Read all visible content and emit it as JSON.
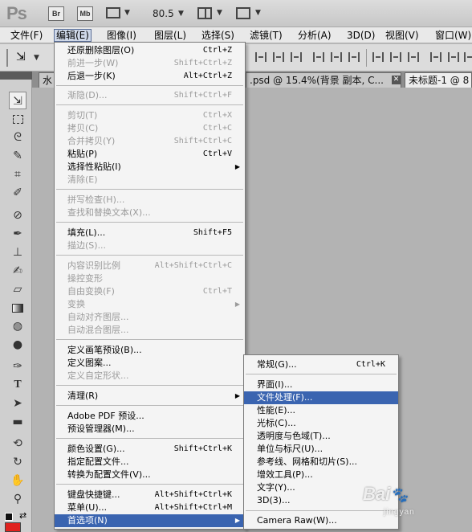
{
  "app": {
    "logo": "Ps",
    "bridge_btn": "Br",
    "minibridge_btn": "Mb",
    "zoom": "80.5"
  },
  "menubar": {
    "items": [
      "文件(F)",
      "编辑(E)",
      "图像(I)",
      "图层(L)",
      "选择(S)",
      "滤镜(T)",
      "分析(A)",
      "3D(D)",
      "视图(V)",
      "窗口(W)"
    ]
  },
  "tabs": [
    {
      "label": "水"
    },
    {
      "label": ".psd @ 15.4%(背景 副本, C..."
    },
    {
      "label": "未标题-1 @ 8"
    }
  ],
  "edit_menu": {
    "items": [
      {
        "label": "还原删除图层(O)",
        "shortcut": "Ctrl+Z",
        "enabled": true
      },
      {
        "label": "前进一步(W)",
        "shortcut": "Shift+Ctrl+Z",
        "enabled": false
      },
      {
        "label": "后退一步(K)",
        "shortcut": "Alt+Ctrl+Z",
        "enabled": true
      },
      {
        "label": "渐隐(D)...",
        "shortcut": "Shift+Ctrl+F",
        "enabled": false
      },
      {
        "label": "剪切(T)",
        "shortcut": "Ctrl+X",
        "enabled": false
      },
      {
        "label": "拷贝(C)",
        "shortcut": "Ctrl+C",
        "enabled": false
      },
      {
        "label": "合并拷贝(Y)",
        "shortcut": "Shift+Ctrl+C",
        "enabled": false
      },
      {
        "label": "粘贴(P)",
        "shortcut": "Ctrl+V",
        "enabled": true
      },
      {
        "label": "选择性粘贴(I)",
        "shortcut": "",
        "enabled": true,
        "submenu": true
      },
      {
        "label": "清除(E)",
        "shortcut": "",
        "enabled": false
      },
      {
        "label": "拼写检查(H)...",
        "shortcut": "",
        "enabled": false
      },
      {
        "label": "查找和替换文本(X)...",
        "shortcut": "",
        "enabled": false
      },
      {
        "label": "填充(L)...",
        "shortcut": "Shift+F5",
        "enabled": true
      },
      {
        "label": "描边(S)...",
        "shortcut": "",
        "enabled": false
      },
      {
        "label": "内容识别比例",
        "shortcut": "Alt+Shift+Ctrl+C",
        "enabled": false
      },
      {
        "label": "操控变形",
        "shortcut": "",
        "enabled": false
      },
      {
        "label": "自由变换(F)",
        "shortcut": "Ctrl+T",
        "enabled": false
      },
      {
        "label": "变换",
        "shortcut": "",
        "enabled": false,
        "submenu": true
      },
      {
        "label": "自动对齐图层...",
        "shortcut": "",
        "enabled": false
      },
      {
        "label": "自动混合图层...",
        "shortcut": "",
        "enabled": false
      },
      {
        "label": "定义画笔预设(B)...",
        "shortcut": "",
        "enabled": true
      },
      {
        "label": "定义图案...",
        "shortcut": "",
        "enabled": true
      },
      {
        "label": "定义自定形状...",
        "shortcut": "",
        "enabled": false
      },
      {
        "label": "清理(R)",
        "shortcut": "",
        "enabled": true,
        "submenu": true
      },
      {
        "label": "Adobe PDF 预设...",
        "shortcut": "",
        "enabled": true
      },
      {
        "label": "预设管理器(M)...",
        "shortcut": "",
        "enabled": true
      },
      {
        "label": "颜色设置(G)...",
        "shortcut": "Shift+Ctrl+K",
        "enabled": true
      },
      {
        "label": "指定配置文件...",
        "shortcut": "",
        "enabled": true
      },
      {
        "label": "转换为配置文件(V)...",
        "shortcut": "",
        "enabled": true
      },
      {
        "label": "键盘快捷键...",
        "shortcut": "Alt+Shift+Ctrl+K",
        "enabled": true
      },
      {
        "label": "菜单(U)...",
        "shortcut": "Alt+Shift+Ctrl+M",
        "enabled": true
      },
      {
        "label": "首选项(N)",
        "shortcut": "",
        "enabled": true,
        "submenu": true,
        "highlighted": true
      }
    ]
  },
  "prefs_submenu": {
    "items": [
      {
        "label": "常规(G)...",
        "shortcut": "Ctrl+K"
      },
      {
        "label": "界面(I)...",
        "shortcut": ""
      },
      {
        "label": "文件处理(F)...",
        "shortcut": "",
        "highlighted": true
      },
      {
        "label": "性能(E)...",
        "shortcut": ""
      },
      {
        "label": "光标(C)...",
        "shortcut": ""
      },
      {
        "label": "透明度与色域(T)...",
        "shortcut": ""
      },
      {
        "label": "单位与标尺(U)...",
        "shortcut": ""
      },
      {
        "label": "参考线、网格和切片(S)...",
        "shortcut": ""
      },
      {
        "label": "增效工具(P)...",
        "shortcut": ""
      },
      {
        "label": "文字(Y)...",
        "shortcut": ""
      },
      {
        "label": "3D(3)...",
        "shortcut": ""
      },
      {
        "label": "Camera Raw(W)...",
        "shortcut": ""
      }
    ]
  },
  "colors": {
    "highlight": "#3a64b0",
    "foreground_swatch": "#000000",
    "background_swatch": "#e0221e"
  },
  "watermark": {
    "text": "Bai",
    "sub": "jingyan"
  }
}
